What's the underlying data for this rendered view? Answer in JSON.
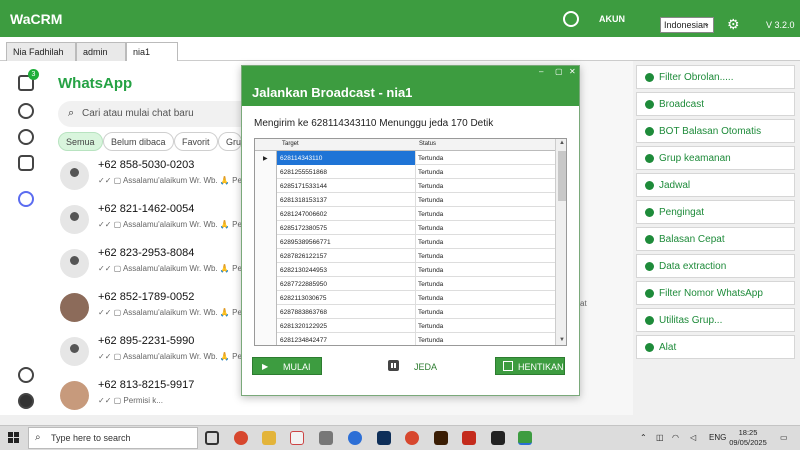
{
  "app": {
    "title": "WaCRM",
    "akun_label": "AKUN",
    "language": "Indonesian",
    "version": "V 3.2.0"
  },
  "tabs": [
    "Nia Fadhilah",
    "admin",
    "nia1"
  ],
  "sidebar": {
    "badge_count": "3"
  },
  "whatsapp": {
    "logo": "WhatsApp",
    "search_placeholder": "Cari atau mulai chat baru",
    "filters": [
      "Semua",
      "Belum dibaca",
      "Favorit",
      "Grup"
    ],
    "chats": [
      {
        "number": "+62 858-5030-0203",
        "preview": "✓✓ ▢ Assalamu'alaikum Wr. Wb. 🙏 Pe"
      },
      {
        "number": "+62 821-1462-0054",
        "preview": "✓✓ ▢ Assalamu'alaikum Wr. Wb. 🙏 Pe"
      },
      {
        "number": "+62 823-2953-8084",
        "preview": "✓✓ ▢ Assalamu'alaikum Wr. Wb. 🙏 Pe"
      },
      {
        "number": "+62 852-1789-0052",
        "preview": "✓✓ ▢ Assalamu'alaikum Wr. Wb. 🙏 Pe"
      },
      {
        "number": "+62 895-2231-5990",
        "preview": "✓✓ ▢ Assalamu'alaikum Wr. Wb. 🙏 Pe"
      },
      {
        "number": "+62 813-8215-9917",
        "preview": "✓✓ ▢ Permisi k..."
      }
    ],
    "stray_text": "at"
  },
  "dialog": {
    "title": "Jalankan Broadcast - nia1",
    "status": "Mengirim ke 628114343110  Menunggu jeda 170 Detik",
    "columns": [
      "Target",
      "Status"
    ],
    "rows": [
      [
        "628114343110",
        "Tertunda"
      ],
      [
        "6281255551868",
        "Tertunda"
      ],
      [
        "6285171533144",
        "Tertunda"
      ],
      [
        "6281318153137",
        "Tertunda"
      ],
      [
        "6281247006602",
        "Tertunda"
      ],
      [
        "6285172380575",
        "Tertunda"
      ],
      [
        "62895389566771",
        "Tertunda"
      ],
      [
        "6287826122157",
        "Tertunda"
      ],
      [
        "6282130244953",
        "Tertunda"
      ],
      [
        "6287722885950",
        "Tertunda"
      ],
      [
        "6282113030675",
        "Tertunda"
      ],
      [
        "6287883863768",
        "Tertunda"
      ],
      [
        "6281320122925",
        "Tertunda"
      ],
      [
        "6281234842477",
        "Tertunda"
      ]
    ],
    "mulai": "MULAI",
    "jeda": "JEDA",
    "hentikan": "HENTIKAN"
  },
  "actions": [
    "Filter Obrolan.....",
    "Broadcast",
    "BOT Balasan Otomatis",
    "Grup keamanan",
    "Jadwal",
    "Pengingat",
    "Balasan Cepat",
    "Data extraction",
    "Filter Nomor WhatsApp",
    "Utilitas Grup...",
    "Alat"
  ],
  "taskbar": {
    "search_placeholder": "Type here to search",
    "lang": "ENG",
    "time": "18:25",
    "date": "09/05/2025"
  },
  "colors": {
    "brand_green": "#3d9c40",
    "selection_blue": "#1f74d6"
  }
}
